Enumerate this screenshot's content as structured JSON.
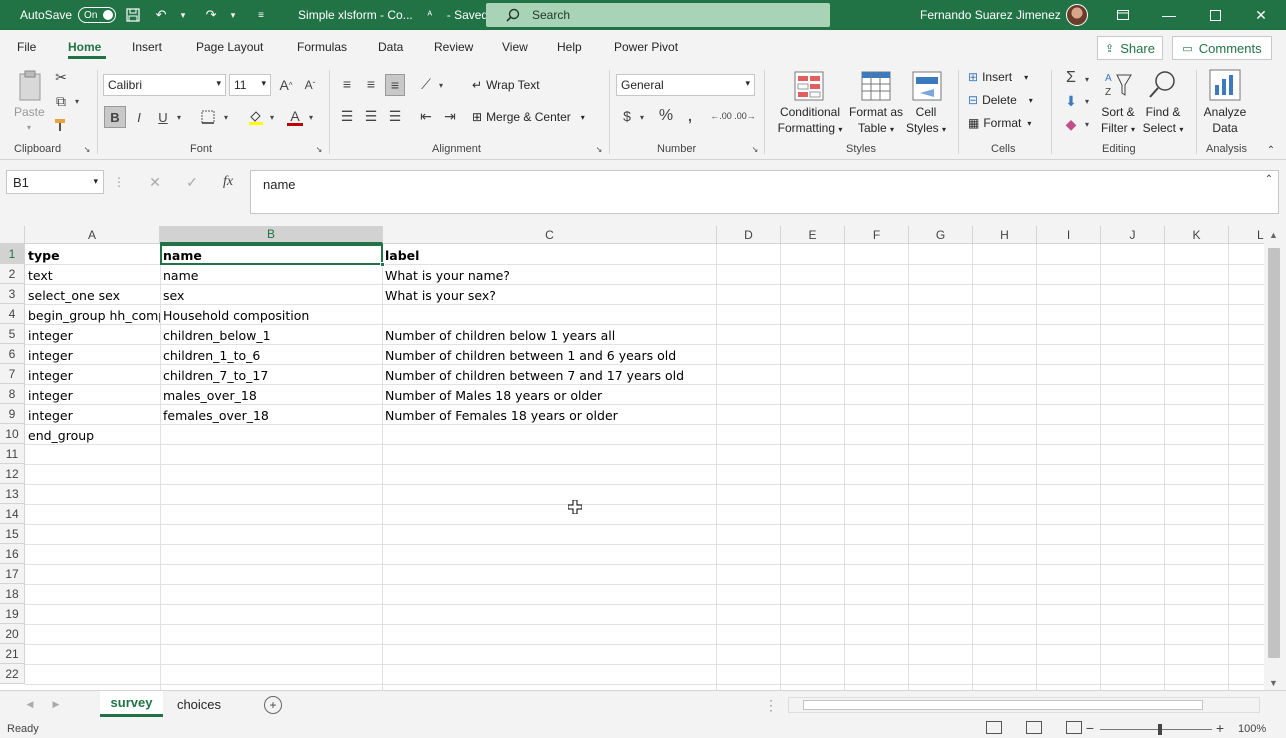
{
  "titlebar": {
    "autosave_label": "AutoSave",
    "autosave_state": "On",
    "doc_title": "Simple xlsform - Co...",
    "saved_label": "-  Saved",
    "search_placeholder": "Search",
    "user_name": "Fernando Suarez Jimenez"
  },
  "tabs": [
    "File",
    "Home",
    "Insert",
    "Page Layout",
    "Formulas",
    "Data",
    "Review",
    "View",
    "Help",
    "Power Pivot"
  ],
  "share_label": "Share",
  "comments_label": "Comments",
  "ribbon": {
    "clipboard": {
      "paste": "Paste",
      "group": "Clipboard"
    },
    "font": {
      "name": "Calibri",
      "size": "11",
      "group": "Font"
    },
    "alignment": {
      "wrap": "Wrap Text",
      "merge": "Merge & Center",
      "group": "Alignment"
    },
    "number": {
      "format": "General",
      "group": "Number"
    },
    "styles": {
      "conditional": [
        "Conditional",
        "Formatting"
      ],
      "format_table": [
        "Format as",
        "Table"
      ],
      "cell_styles": [
        "Cell",
        "Styles"
      ],
      "group": "Styles"
    },
    "cells": {
      "insert": "Insert",
      "delete": "Delete",
      "format": "Format",
      "group": "Cells"
    },
    "editing": {
      "sort": [
        "Sort &",
        "Filter"
      ],
      "find": [
        "Find &",
        "Select"
      ],
      "group": "Editing"
    },
    "analysis": {
      "analyze": [
        "Analyze",
        "Data"
      ],
      "group": "Analysis"
    }
  },
  "formula_bar": {
    "name_box": "B1",
    "content": "name"
  },
  "columns": [
    "A",
    "B",
    "C",
    "D",
    "E",
    "F",
    "G",
    "H",
    "I",
    "J",
    "K",
    "L"
  ],
  "rows": [
    "1",
    "2",
    "3",
    "4",
    "5",
    "6",
    "7",
    "8",
    "9",
    "10",
    "11",
    "12",
    "13",
    "14",
    "15",
    "16",
    "17",
    "18",
    "19",
    "20",
    "21",
    "22"
  ],
  "cells": {
    "A1": "type",
    "B1": "name",
    "C1": "label",
    "A2": "text",
    "B2": "name",
    "C2": "What is your name?",
    "A3": "select_one sex",
    "B3": "sex",
    "C3": "What is your sex?",
    "A4": "begin_group hh_comp",
    "B4": "Household composition",
    "A5": "integer",
    "B5": "children_below_1",
    "C5": "Number of children below 1 years all",
    "A6": "integer",
    "B6": "children_1_to_6",
    "C6": "Number of children between 1 and 6 years old",
    "A7": "integer",
    "B7": "children_7_to_17",
    "C7": "Number of children between 7 and 17 years old",
    "A8": "integer",
    "B8": "males_over_18",
    "C8": "Number of Males 18 years or older",
    "A9": "integer",
    "B9": "females_over_18",
    "C9": "Number of Females 18 years or older",
    "A10": "end_group"
  },
  "sheets": [
    "survey",
    "choices"
  ],
  "status": {
    "ready": "Ready",
    "zoom": "100%"
  }
}
